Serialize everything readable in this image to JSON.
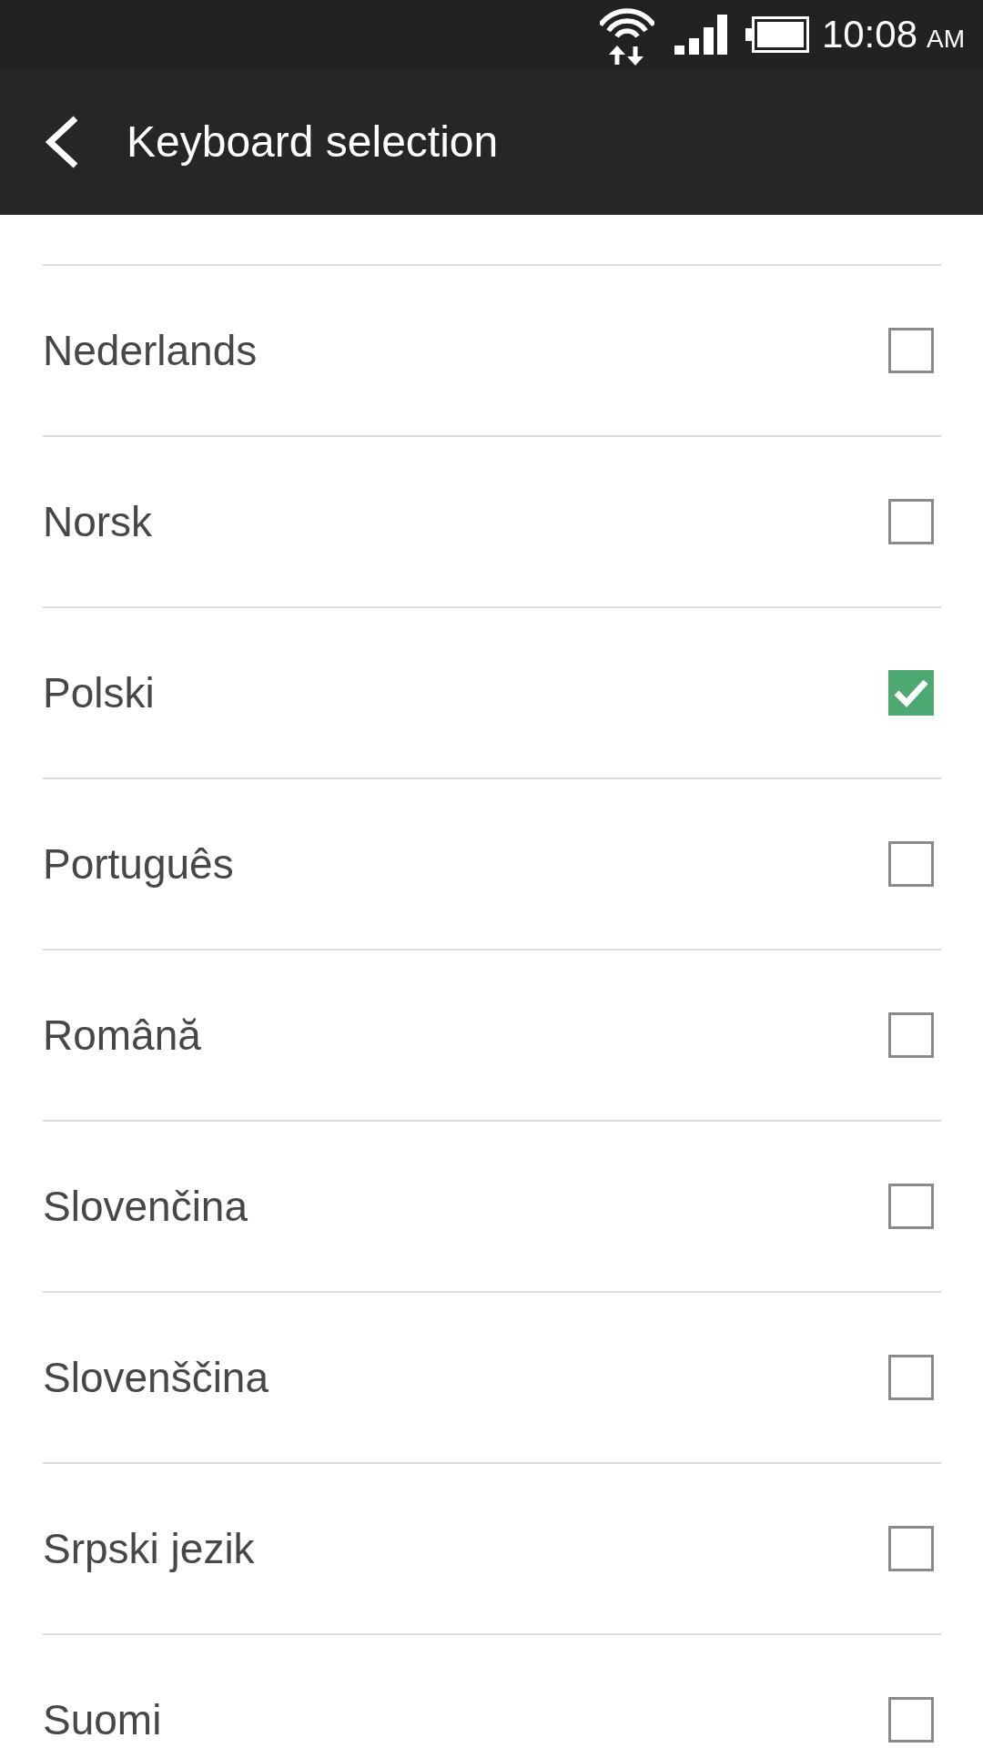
{
  "status_bar": {
    "time": "10:08",
    "meridiem": "AM"
  },
  "header": {
    "title": "Keyboard selection"
  },
  "languages": [
    {
      "name": "Nederlands",
      "checked": false
    },
    {
      "name": "Norsk",
      "checked": false
    },
    {
      "name": "Polski",
      "checked": true
    },
    {
      "name": "Português",
      "checked": false
    },
    {
      "name": "Română",
      "checked": false
    },
    {
      "name": "Slovenčina",
      "checked": false
    },
    {
      "name": "Slovenščina",
      "checked": false
    },
    {
      "name": "Srpski jezik",
      "checked": false
    },
    {
      "name": "Suomi",
      "checked": false
    }
  ]
}
